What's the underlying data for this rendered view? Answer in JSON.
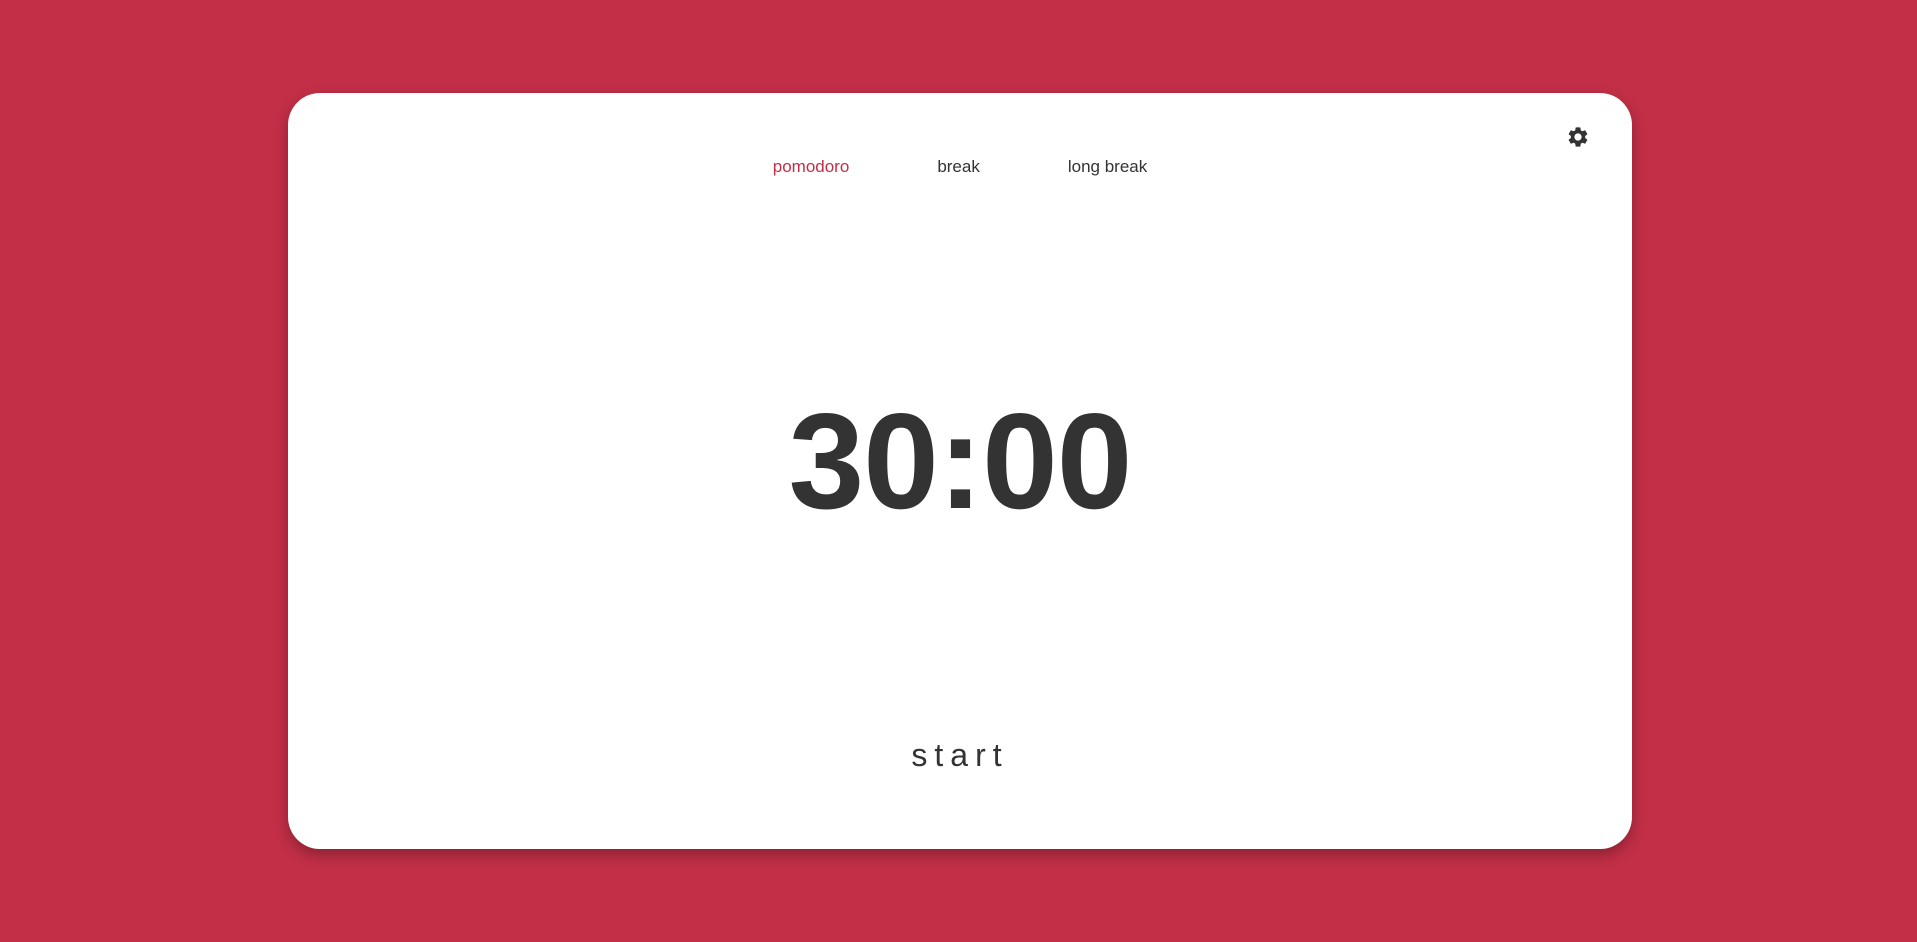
{
  "theme": {
    "background_color": "#c22f46",
    "accent_color": "#c22f46",
    "card_color": "#ffffff",
    "text_color": "#333333"
  },
  "header": {
    "settings_icon": "gear-icon"
  },
  "tabs": [
    {
      "label": "pomodoro",
      "active": true
    },
    {
      "label": "break",
      "active": false
    },
    {
      "label": "long break",
      "active": false
    }
  ],
  "timer": {
    "display": "30:00"
  },
  "controls": {
    "start_label": "start"
  }
}
